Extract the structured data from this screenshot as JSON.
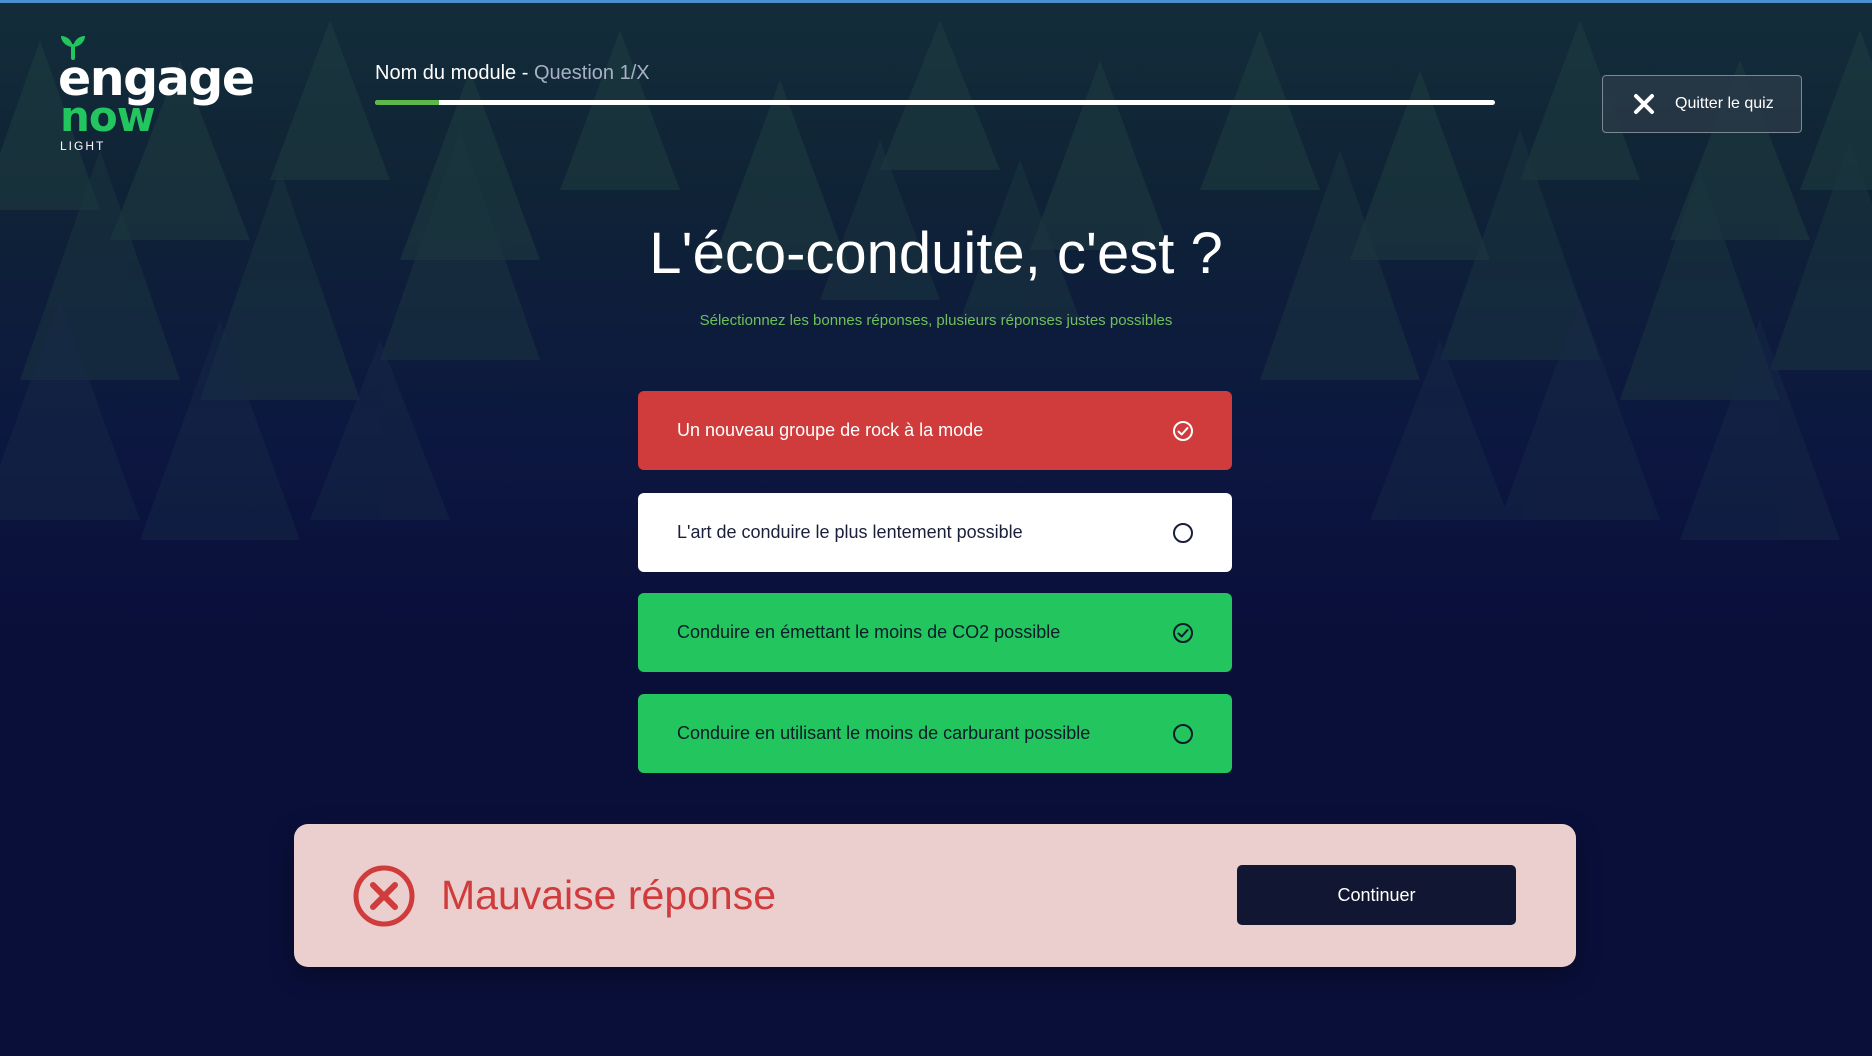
{
  "logo": {
    "line1": "engage",
    "line2": "now",
    "line3": "LIGHT"
  },
  "header": {
    "module_name": "Nom du module - ",
    "question_counter": "Question 1/X",
    "progress_fraction": 0.057
  },
  "quit_button": {
    "label": "Quitter le quiz",
    "icon": "close-icon"
  },
  "question": {
    "title": "L'éco-conduite, c'est ?",
    "hint": "Sélectionnez les bonnes réponses, plusieurs réponses justes possibles"
  },
  "answers": [
    {
      "label": "Un nouveau groupe de rock à la mode",
      "state": "wrong-selected",
      "icon": "check-circle-icon"
    },
    {
      "label": "L'art de conduire le plus lentement possible",
      "state": "unselected",
      "icon": "empty-circle-icon"
    },
    {
      "label": "Conduire en émettant le moins de CO2 possible",
      "state": "correct-selected",
      "icon": "check-circle-icon"
    },
    {
      "label": "Conduire en utilisant le moins de carburant possible",
      "state": "correct-missed",
      "icon": "empty-circle-icon"
    }
  ],
  "feedback": {
    "message": "Mauvaise réponse",
    "icon": "error-circle-icon",
    "continue_label": "Continuer"
  },
  "colors": {
    "background": "#0a0f3a",
    "brand_green": "#22c55e",
    "error_red": "#d03b3b",
    "feedback_bg": "#ebcfcf",
    "progress_fill": "#5fb84a",
    "hint_green": "#6fc05a",
    "button_dark": "#111733"
  }
}
